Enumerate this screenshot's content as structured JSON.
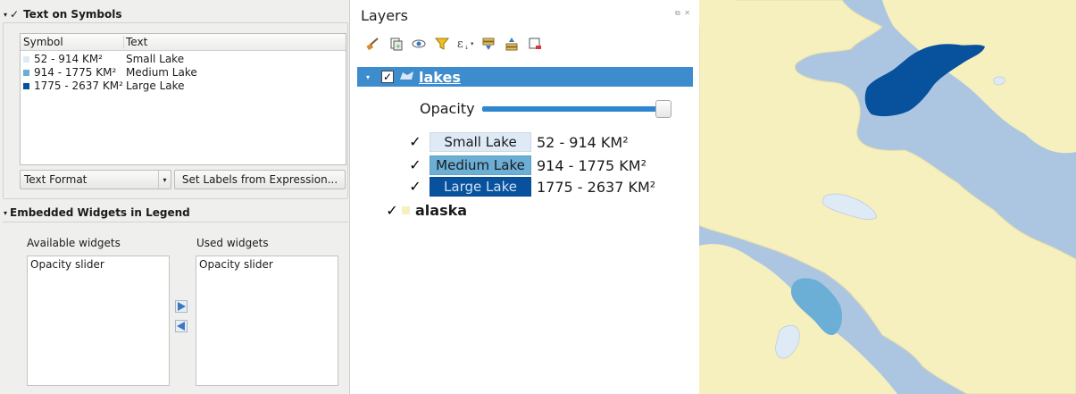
{
  "left_panel": {
    "text_on_symbols": {
      "title": "Text on Symbols",
      "checked": true,
      "table": {
        "headers": [
          "Symbol",
          "Text"
        ],
        "rows": [
          {
            "symbol": "52 - 914 KM²",
            "text": "Small Lake",
            "color": "#deebf7"
          },
          {
            "symbol": "914 - 1775 KM²",
            "text": "Medium Lake",
            "color": "#6baed6"
          },
          {
            "symbol": "1775 - 2637 KM²",
            "text": "Large Lake",
            "color": "#08519c"
          }
        ]
      },
      "text_format_combo": "Text Format",
      "set_labels_button": "Set Labels from Expression..."
    },
    "embedded_widgets": {
      "title": "Embedded Widgets in Legend",
      "available_label": "Available widgets",
      "used_label": "Used widgets",
      "available_items": [
        "Opacity slider"
      ],
      "used_items": [
        "Opacity slider"
      ]
    }
  },
  "layers_panel": {
    "title": "Layers",
    "toolbar_icons": [
      "style-brush-icon",
      "add-group-icon",
      "eye-icon",
      "filter-icon",
      "expression-filter-icon",
      "expand-all-icon",
      "collapse-all-icon",
      "remove-layer-icon"
    ],
    "layers": [
      {
        "name": "lakes",
        "checked": true,
        "selected": true,
        "opacity_label": "Opacity",
        "opacity": 1.0,
        "classes": [
          {
            "label": "Small Lake",
            "range": "52 - 914 KM²",
            "color": "#deebf7",
            "text_color": "#1b1b1b",
            "checked": true
          },
          {
            "label": "Medium Lake",
            "range": "914 - 1775 KM²",
            "color": "#6baed6",
            "text_color": "#1b1b1b",
            "checked": true
          },
          {
            "label": "Large Lake",
            "range": "1775 - 2637 KM²",
            "color": "#08519c",
            "text_color": "#cfe1f2",
            "checked": true
          }
        ]
      },
      {
        "name": "alaska",
        "checked": true,
        "color": "#f6efbe"
      }
    ]
  },
  "colors": {
    "selection": "#3c8cce",
    "water": "#acc6e2",
    "land": "#f6efbe"
  }
}
